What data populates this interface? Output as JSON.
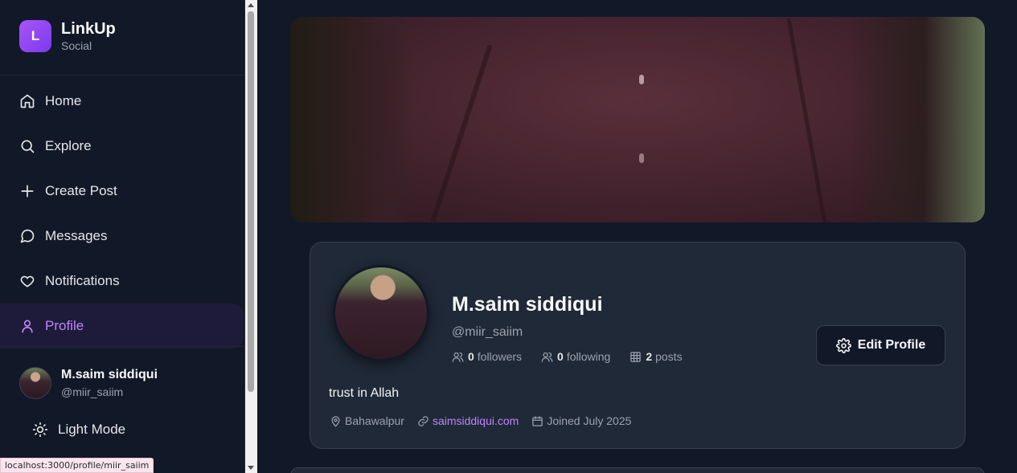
{
  "brand": {
    "logo_letter": "L",
    "name": "LinkUp",
    "tagline": "Social"
  },
  "nav": {
    "items": [
      {
        "label": "Home",
        "icon": "home-icon"
      },
      {
        "label": "Explore",
        "icon": "search-icon"
      },
      {
        "label": "Create Post",
        "icon": "plus-icon"
      },
      {
        "label": "Messages",
        "icon": "message-icon"
      },
      {
        "label": "Notifications",
        "icon": "heart-icon"
      },
      {
        "label": "Profile",
        "icon": "user-icon",
        "active": true
      }
    ]
  },
  "current_user": {
    "name": "M.saim siddiqui",
    "handle": "@miir_saiim"
  },
  "theme_toggle": {
    "label": "Light Mode",
    "icon": "sun-icon"
  },
  "status_bar": {
    "url": "localhost:3000/profile/miir_saiim"
  },
  "profile": {
    "name": "M.saim siddiqui",
    "handle": "@miir_saiim",
    "stats": {
      "followers_count": "0",
      "followers_label": "followers",
      "following_count": "0",
      "following_label": "following",
      "posts_count": "2",
      "posts_label": "posts"
    },
    "edit_label": "Edit Profile",
    "bio": "trust in Allah",
    "location": "Bahawalpur",
    "website": "saimsiddiqui.com",
    "joined": "Joined July 2025"
  },
  "colors": {
    "accent": "#c084fc",
    "background": "#111827",
    "card": "#1f2937"
  }
}
